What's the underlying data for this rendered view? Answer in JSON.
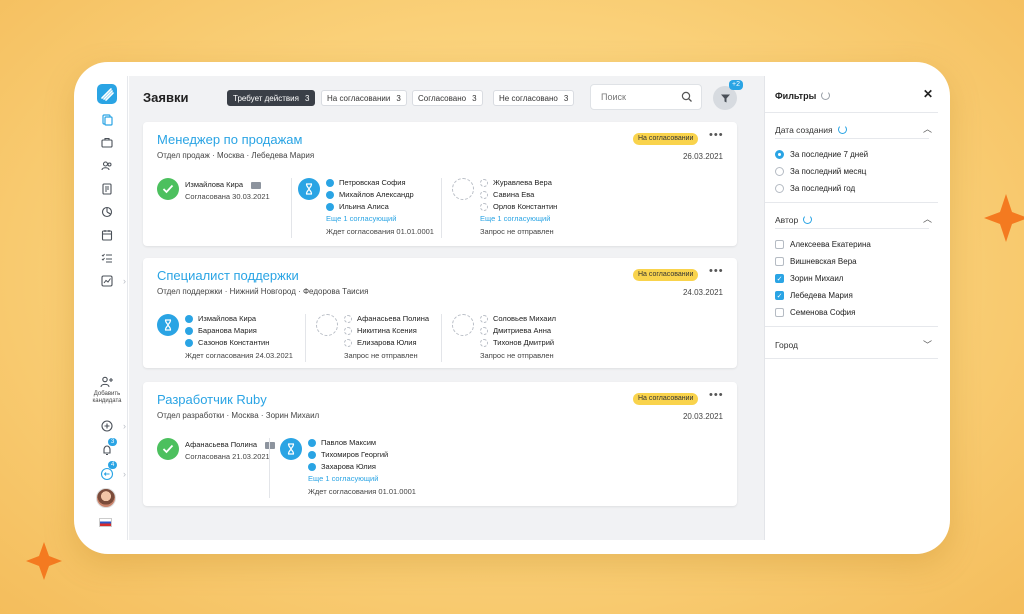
{
  "header": {
    "title": "Заявки",
    "tabs": [
      {
        "label": "Требует действия",
        "count": "3"
      },
      {
        "label": "На согласовании",
        "count": "3"
      },
      {
        "label": "Согласовано",
        "count": "3"
      },
      {
        "label": "Не согласовано",
        "count": "3"
      }
    ],
    "search_placeholder": "Поиск",
    "filter_badge": "+2"
  },
  "sidebar": {
    "add_candidate": "Добавить кандидата",
    "notif_badge": "3",
    "msg_badge": "4"
  },
  "cards": [
    {
      "title": "Менеджер по продажам",
      "subtitle": "Отдел продаж · Москва · Лебедева Мария",
      "status": "На согласовании",
      "date": "26.03.2021",
      "stage1": {
        "name": "Измайлова Кира",
        "note": "Согласована 30.03.2021"
      },
      "stage2": {
        "people": [
          "Петровская София",
          "Михайлов Александр",
          "Ильина Алиса"
        ],
        "more": "Еще 1 согласующий",
        "note": "Ждет согласования 01.01.0001"
      },
      "stage3": {
        "people": [
          "Журавлева Вера",
          "Савина Ева",
          "Орлов Константин"
        ],
        "more": "Еще 1 согласующий",
        "note": "Запрос не отправлен"
      }
    },
    {
      "title": "Специалист поддержки",
      "subtitle": "Отдел поддержки · Нижний Новгород · Федорова Таисия",
      "status": "На согласовании",
      "date": "24.03.2021",
      "stage1": {
        "people": [
          "Измайлова Кира",
          "Баранова Мария",
          "Сазонов Константин"
        ],
        "note": "Ждет согласования 24.03.2021"
      },
      "stage2": {
        "people": [
          "Афанасьева Полина",
          "Никитина Ксения",
          "Елизарова Юлия"
        ],
        "note": "Запрос не отправлен"
      },
      "stage3": {
        "people": [
          "Соловьев Михаил",
          "Дмитриева Анна",
          "Тихонов Дмитрий"
        ],
        "note": "Запрос не отправлен"
      }
    },
    {
      "title": "Разработчик Ruby",
      "subtitle": "Отдел разработки · Москва · Зорин Михаил",
      "status": "На согласовании",
      "date": "20.03.2021",
      "stage1": {
        "name": "Афанасьева Полина",
        "note": "Согласована 21.03.2021"
      },
      "stage2": {
        "people": [
          "Павлов Максим",
          "Тихомиров Георгий",
          "Захарова Юлия"
        ],
        "more": "Еще 1 согласующий",
        "note": "Ждет согласования 01.01.0001"
      }
    }
  ],
  "filters": {
    "title": "Фильтры",
    "date_section": "Дата создания",
    "date_options": [
      "За последние 7 дней",
      "За последний месяц",
      "За последний год"
    ],
    "author_section": "Автор",
    "authors": [
      {
        "name": "Алексеева Екатерина",
        "checked": false
      },
      {
        "name": "Вишневская Вера",
        "checked": false
      },
      {
        "name": "Зорин Михаил",
        "checked": true
      },
      {
        "name": "Лебедева Мария",
        "checked": true
      },
      {
        "name": "Семенова София",
        "checked": false
      }
    ],
    "city_section": "Город"
  },
  "colors": {
    "accent": "#2aa4e4",
    "success": "#4cc05e",
    "status": "#f9d34c",
    "frame": "#f7c96a",
    "star": "#f47a20"
  }
}
